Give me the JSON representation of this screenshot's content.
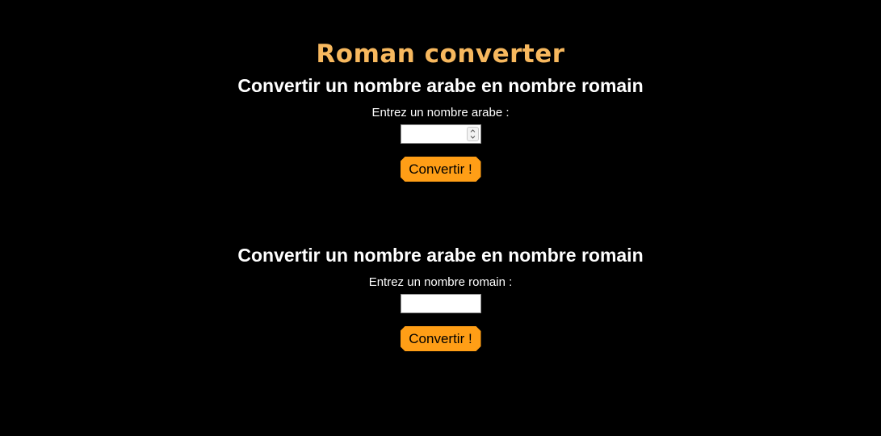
{
  "page": {
    "title": "Roman converter"
  },
  "sections": [
    {
      "heading": "Convertir un nombre arabe en nombre romain",
      "input_label": "Entrez un nombre arabe :",
      "input_value": "",
      "input_type": "number",
      "button_label": "Convertir !"
    },
    {
      "heading": "Convertir un nombre arabe en nombre romain",
      "input_label": "Entrez un nombre romain :",
      "input_value": "",
      "input_type": "text",
      "button_label": "Convertir !"
    }
  ],
  "colors": {
    "background": "#000000",
    "title": "#f7b85e",
    "button": "#ff9e16",
    "text": "#ffffff"
  },
  "icons": {
    "spinner": "number-spinner-icon"
  }
}
